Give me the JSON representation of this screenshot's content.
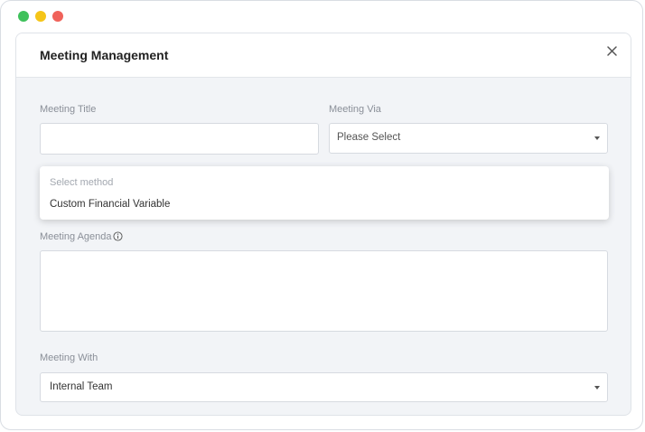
{
  "window": {
    "traffic_lights": [
      {
        "name": "green",
        "color": "#3fc15b"
      },
      {
        "name": "yellow",
        "color": "#f5c518"
      },
      {
        "name": "red",
        "color": "#f0625a"
      }
    ]
  },
  "modal": {
    "title": "Meeting Management",
    "close_icon": "close-icon"
  },
  "form": {
    "meeting_title": {
      "label": "Meeting Title",
      "value": ""
    },
    "meeting_via": {
      "label": "Meeting Via",
      "selected": "Please Select"
    },
    "method_dropdown": {
      "placeholder": "Select method",
      "options": [
        "Custom Financial Variable"
      ]
    },
    "meeting_agenda": {
      "label": "Meeting Agenda",
      "value": "",
      "info_icon": "info-icon"
    },
    "meeting_with": {
      "label": "Meeting With",
      "selected": "Internal Team"
    }
  }
}
